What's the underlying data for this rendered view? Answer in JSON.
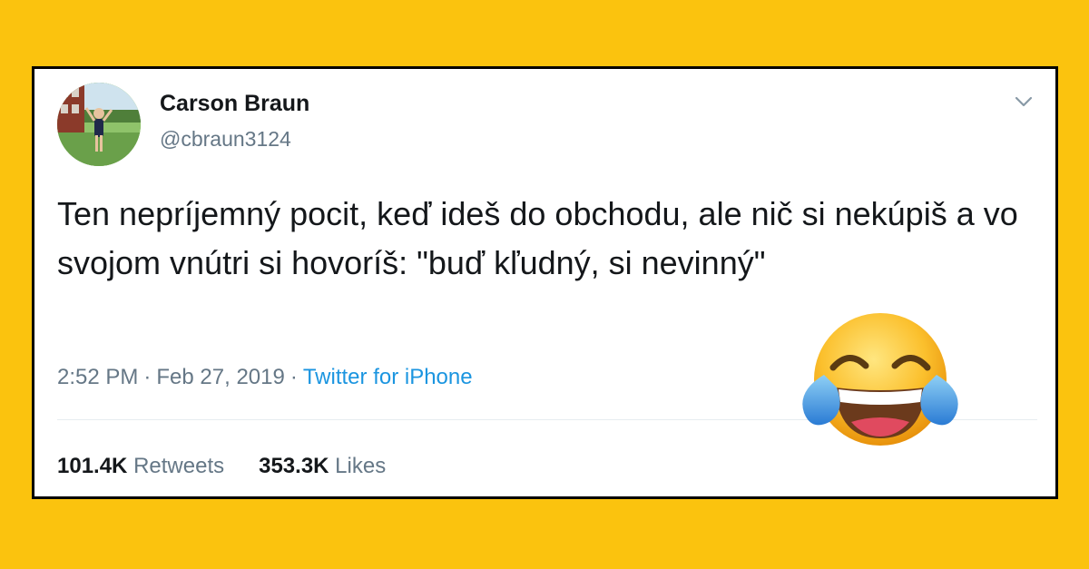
{
  "tweet": {
    "author_name": "Carson Braun",
    "author_handle": "@cbraun3124",
    "text": "Ten nepríjemný pocit, keď ideš do obchodu, ale nič si nekúpiš a vo svojom vnútri si hovoríš: \"buď kľudný, si nevinný\"",
    "time": "2:52 PM",
    "date": "Feb 27, 2019",
    "separator": "·",
    "source": "Twitter for iPhone",
    "retweets_count": "101.4K",
    "retweets_label": "Retweets",
    "likes_count": "353.3K",
    "likes_label": "Likes"
  },
  "icons": {
    "menu": "chevron-down-icon",
    "emoji": "face-with-tears-of-joy-icon",
    "avatar": "profile-photo"
  },
  "colors": {
    "background": "#FBC30E",
    "card": "#FFFFFF",
    "border": "#000000",
    "text": "#14171A",
    "muted": "#657786",
    "link": "#1B95E0"
  }
}
